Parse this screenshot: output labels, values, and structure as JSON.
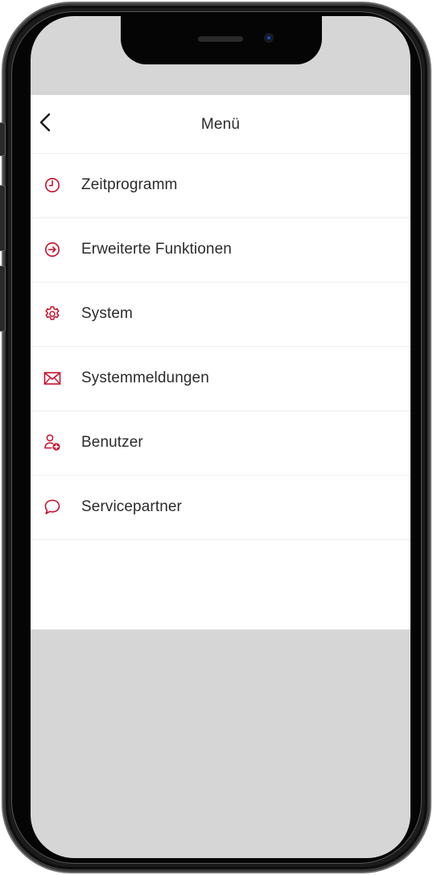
{
  "theme": {
    "accent": "#c8102e",
    "text": "#2c2c2c",
    "divider": "#efefef",
    "screen_background": "#d6d6d6"
  },
  "header": {
    "back_icon": "chevron-left-icon",
    "title": "Menü"
  },
  "menu": {
    "items": [
      {
        "label": "Zeitprogramm",
        "icon": "clock-icon"
      },
      {
        "label": "Erweiterte Funktionen",
        "icon": "arrow-circle-right-icon"
      },
      {
        "label": "System",
        "icon": "gear-icon"
      },
      {
        "label": "Systemmeldungen",
        "icon": "envelope-icon"
      },
      {
        "label": "Benutzer",
        "icon": "user-add-icon"
      },
      {
        "label": "Servicepartner",
        "icon": "chat-bubble-icon"
      }
    ]
  }
}
